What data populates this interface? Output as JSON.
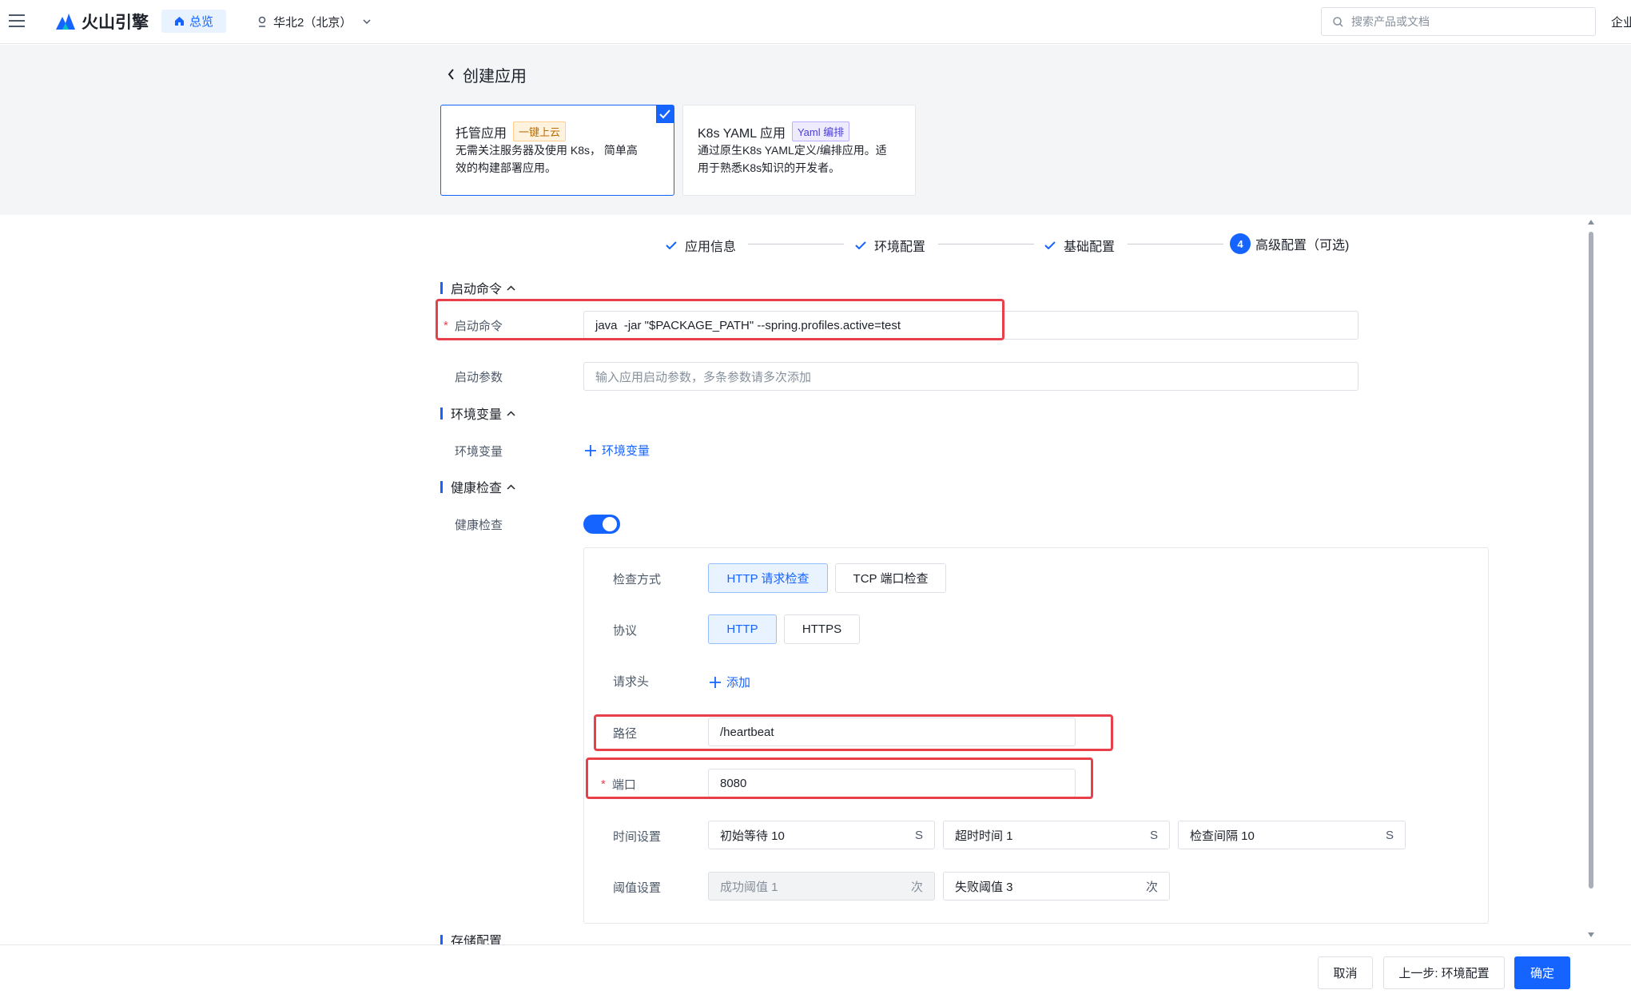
{
  "topbar": {
    "brand": "火山引擎",
    "overview": "总览",
    "region": "华北2（北京）",
    "search_placeholder": "搜索产品或文档",
    "right_cut": "企业"
  },
  "page": {
    "title": "创建应用"
  },
  "cards": [
    {
      "title": "托管应用",
      "badge": "一键上云",
      "desc1": "无需关注服务器及使用 K8s， 简单高",
      "desc2": "效的构建部署应用。",
      "selected": true
    },
    {
      "title": "K8s YAML 应用",
      "badge": "Yaml 编排",
      "desc1": "通过原生K8s YAML定义/编排应用。适",
      "desc2": "用于熟悉K8s知识的开发者。",
      "selected": false
    }
  ],
  "steps": [
    {
      "label": "应用信息",
      "state": "done"
    },
    {
      "label": "环境配置",
      "state": "done"
    },
    {
      "label": "基础配置",
      "state": "done"
    },
    {
      "label": "高级配置（可选)",
      "state": "current",
      "number": "4"
    }
  ],
  "startup": {
    "section": "启动命令",
    "cmd_label": "启动命令",
    "cmd_value": "java  -jar \"$PACKAGE_PATH\" --spring.profiles.active=test",
    "args_label": "启动参数",
    "args_placeholder": "输入应用启动参数，多条参数请多次添加"
  },
  "env": {
    "section": "环境变量",
    "label": "环境变量",
    "add_label": "环境变量"
  },
  "health": {
    "section": "健康检查",
    "toggle_label": "健康检查",
    "toggle_on": true,
    "method_label": "检查方式",
    "methods": [
      "HTTP 请求检查",
      "TCP 端口检查"
    ],
    "protocol_label": "协议",
    "protocols": [
      "HTTP",
      "HTTPS"
    ],
    "header_label": "请求头",
    "header_add": "添加",
    "path_label": "路径",
    "path_value": "/heartbeat",
    "port_label": "端口",
    "port_value": "8080",
    "time_label": "时间设置",
    "time_fields": [
      {
        "text": "初始等待 10",
        "unit": "S"
      },
      {
        "text": "超时时间 1",
        "unit": "S"
      },
      {
        "text": "检查间隔 10",
        "unit": "S"
      }
    ],
    "threshold_label": "阈值设置",
    "threshold_fields": [
      {
        "text": "成功阈值 1",
        "unit": "次"
      },
      {
        "text": "失败阈值 3",
        "unit": "次"
      }
    ]
  },
  "next_section_cut": "存储配置",
  "footer": {
    "cancel": "取消",
    "prev": "上一步: 环境配置",
    "confirm": "确定"
  },
  "colors": {
    "accent": "#1664ff",
    "highlight": "#e8404a"
  }
}
